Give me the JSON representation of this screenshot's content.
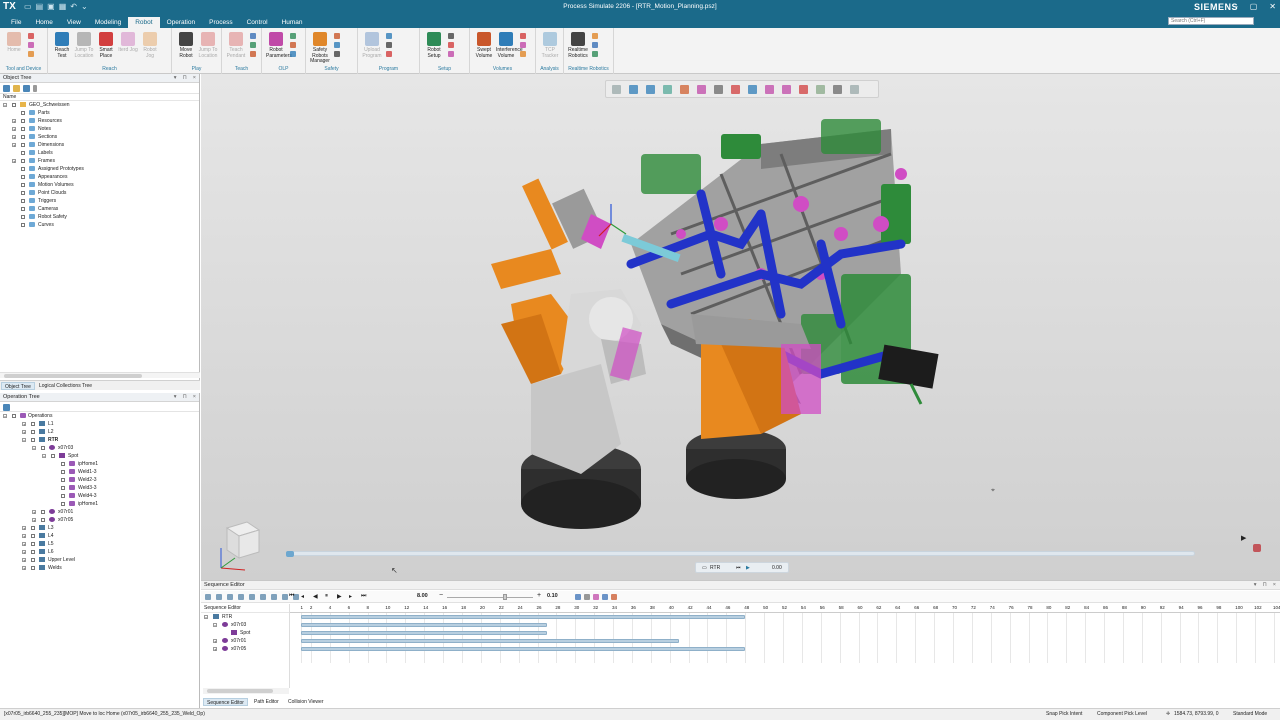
{
  "app": {
    "logo": "TX",
    "title": "Process Simulate 2206 - [RTR_Motion_Planning.psz]",
    "brand": "SIEMENS",
    "search_placeholder": "Search (Ctrl+F)"
  },
  "menu": {
    "tabs": [
      "File",
      "Home",
      "View",
      "Modeling",
      "Robot",
      "Operation",
      "Process",
      "Control",
      "Human"
    ],
    "active": "Robot"
  },
  "ribbon": {
    "groups": [
      {
        "name": "Tool and Device",
        "buttons": [
          {
            "label": "Home",
            "dim": true,
            "icon": "home-pose-icon"
          }
        ]
      },
      {
        "name": "Reach",
        "buttons": [
          {
            "label": "Reach Test",
            "icon": "reach-test-icon"
          },
          {
            "label": "Jump To Location",
            "dim": true,
            "icon": "jump-location-icon"
          },
          {
            "label": "Smart Place",
            "icon": "smart-place-icon"
          },
          {
            "label": "Iterd Jog",
            "dim": true,
            "icon": "jog-icon"
          },
          {
            "label": "Robot Jog",
            "dim": true,
            "icon": "robot-jog-icon"
          }
        ]
      },
      {
        "name": "Play",
        "buttons": [
          {
            "label": "Move Robot",
            "icon": "move-robot-icon"
          },
          {
            "label": "Jump To Location",
            "dim": true,
            "icon": "jump-location-icon"
          }
        ]
      },
      {
        "name": "Teach",
        "buttons": [
          {
            "label": "Teach Pendant",
            "dim": true,
            "icon": "teach-pendant-icon"
          }
        ]
      },
      {
        "name": "OLP",
        "buttons": [
          {
            "label": "Robot Parameters",
            "icon": "robot-parameters-icon"
          }
        ]
      },
      {
        "name": "Safety",
        "buttons": [
          {
            "label": "Safety Robots Manager",
            "icon": "safety-robots-icon"
          }
        ]
      },
      {
        "name": "Program",
        "buttons": [
          {
            "label": "Upload Program",
            "dim": true,
            "icon": "upload-program-icon"
          }
        ]
      },
      {
        "name": "Setup",
        "buttons": [
          {
            "label": "Robot Setup",
            "icon": "robot-setup-icon"
          }
        ]
      },
      {
        "name": "Volumes",
        "buttons": [
          {
            "label": "Swept Volume",
            "icon": "swept-volume-icon"
          },
          {
            "label": "Interference Volume",
            "icon": "interference-volume-icon"
          }
        ]
      },
      {
        "name": "Analysis",
        "buttons": [
          {
            "label": "TCP Tracker",
            "dim": true,
            "icon": "tcp-tracker-icon"
          }
        ]
      },
      {
        "name": "Realtime Robotics",
        "buttons": [
          {
            "label": "Realtime Robotics",
            "icon": "realtime-robotics-icon"
          }
        ]
      }
    ]
  },
  "object_tree": {
    "title": "Object Tree",
    "column": "Name",
    "root": "GEO_Schweissen",
    "items": [
      "Parts",
      "Resources",
      "Notes",
      "Sections",
      "Dimensions",
      "Labels",
      "Frames",
      "Assigned Prototypes",
      "Appearances",
      "Motion Volumes",
      "Point Clouds",
      "Triggers",
      "Cameras",
      "Robot Safety",
      "Curves"
    ],
    "tabs": [
      "Object Tree",
      "Logical Collections Tree"
    ]
  },
  "operation_tree": {
    "title": "Operation Tree",
    "root": "Operations",
    "items": [
      {
        "label": "L1",
        "level": 1,
        "icon": "line"
      },
      {
        "label": "L2",
        "level": 1,
        "icon": "line"
      },
      {
        "label": "RTR",
        "level": 1,
        "icon": "line",
        "bold": true
      },
      {
        "label": "x07r03",
        "level": 2,
        "icon": "robot"
      },
      {
        "label": "Spot",
        "level": 3,
        "icon": "spot"
      },
      {
        "label": "ipHome1",
        "level": 4,
        "icon": "op"
      },
      {
        "label": "Weld1-3",
        "level": 4,
        "icon": "op"
      },
      {
        "label": "Weld2-3",
        "level": 4,
        "icon": "op"
      },
      {
        "label": "Weld3-3",
        "level": 4,
        "icon": "op"
      },
      {
        "label": "Weld4-3",
        "level": 4,
        "icon": "op"
      },
      {
        "label": "ipHome1",
        "level": 4,
        "icon": "op"
      },
      {
        "label": "x07r01",
        "level": 2,
        "icon": "robot"
      },
      {
        "label": "x07r05",
        "level": 2,
        "icon": "robot"
      },
      {
        "label": "L3",
        "level": 1,
        "icon": "line"
      },
      {
        "label": "L4",
        "level": 1,
        "icon": "line"
      },
      {
        "label": "L5",
        "level": 1,
        "icon": "line"
      },
      {
        "label": "L6",
        "level": 1,
        "icon": "line"
      },
      {
        "label": "Upper Level",
        "level": 1,
        "icon": "line"
      },
      {
        "label": "Welds",
        "level": 1,
        "icon": "line"
      }
    ]
  },
  "viewport": {
    "sim_label": "RTR",
    "sim_time": "0.00"
  },
  "sequence_editor": {
    "title": "Sequence Editor",
    "column": "Sequence Editor",
    "time": "8.00",
    "step": "0.10",
    "rows": [
      {
        "label": "RTR",
        "level": 0
      },
      {
        "label": "x07r03",
        "level": 1
      },
      {
        "label": "Spot",
        "level": 2
      },
      {
        "label": "x07r01",
        "level": 1
      },
      {
        "label": "x07r05",
        "level": 1
      }
    ],
    "ruler": [
      "1",
      "2",
      "4",
      "6",
      "8",
      "10",
      "12",
      "14",
      "16",
      "18",
      "20",
      "22",
      "24",
      "26",
      "28",
      "30",
      "32",
      "34",
      "36",
      "38",
      "40",
      "42",
      "44",
      "46",
      "48",
      "50",
      "52",
      "54",
      "56",
      "58",
      "60",
      "62",
      "64",
      "66",
      "68",
      "70",
      "72",
      "74",
      "76",
      "78",
      "80",
      "82",
      "84",
      "86",
      "88",
      "90",
      "92",
      "94",
      "96",
      "98",
      "100",
      "102",
      "104"
    ],
    "bars": [
      {
        "row": 0,
        "start": 1,
        "end": 48
      },
      {
        "row": 1,
        "start": 1,
        "end": 27
      },
      {
        "row": 2,
        "start": 1,
        "end": 27
      },
      {
        "row": 3,
        "start": 1,
        "end": 41
      },
      {
        "row": 4,
        "start": 1,
        "end": 48
      }
    ],
    "tabs": [
      "Sequence Editor",
      "Path Editor",
      "Collision Viewer"
    ]
  },
  "status": {
    "message": "[x07r05_irb6640_255_235][MOP] Move to loc Home (x07r05_irb6640_255_235_Weld_Op)",
    "snap": "Snap Pick Intent",
    "pick": "Component Pick Level",
    "coords": "1584.73, 8793.99, 0",
    "mode": "Standard Mode"
  },
  "colors": {
    "titlebar": "#1b6a8a",
    "accent": "#2a7aa0",
    "robot_orange": "#e8891f",
    "robot_white": "#d8d8d8",
    "fixture_blue": "#2233c8",
    "fixture_green": "#2e8b3a",
    "fixture_gray": "#8a8a8a"
  }
}
